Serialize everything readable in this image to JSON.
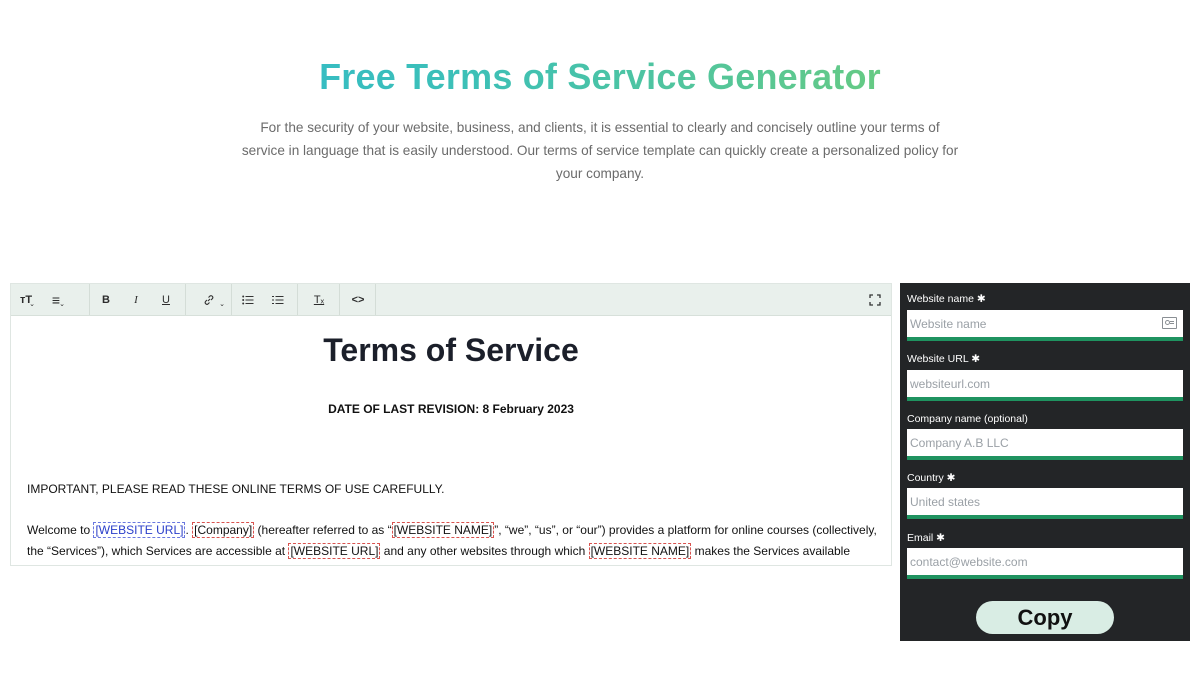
{
  "hero": {
    "title": "Free Terms of Service Generator",
    "description": "For the security of your website, business, and clients, it is essential to clearly and concisely outline your terms of service in language that is easily understood. Our terms of service template can quickly create a personalized policy for your company."
  },
  "toolbar": {
    "buttons": [
      {
        "name": "text-size-icon",
        "glyph": "ᴛT"
      },
      {
        "name": "align-icon",
        "glyph": "≡"
      },
      {
        "name": "bold-icon",
        "glyph": "B"
      },
      {
        "name": "italic-icon",
        "glyph": "I"
      },
      {
        "name": "underline-icon",
        "glyph": "U"
      },
      {
        "name": "link-icon",
        "glyph": "🔗"
      },
      {
        "name": "bullet-list-icon",
        "glyph": "☰"
      },
      {
        "name": "numbered-list-icon",
        "glyph": "☰"
      },
      {
        "name": "clear-format-icon",
        "glyph": "Tₓ"
      },
      {
        "name": "code-view-icon",
        "glyph": "<>"
      },
      {
        "name": "fullscreen-icon",
        "glyph": "⛶"
      }
    ]
  },
  "document": {
    "title": "Terms of Service",
    "date_line": "DATE OF LAST REVISION: 8 February 2023",
    "important": "IMPORTANT, PLEASE READ THESE ONLINE TERMS OF USE CAREFULLY.",
    "para": {
      "t1": "Welcome to ",
      "ph_website_url": "[WEBSITE URL]",
      "t2": ". ",
      "ph_company": "[Company]",
      "t3": " (hereafter referred to as “",
      "ph_website_name": "[WEBSITE NAME]",
      "t4": "”, “we”, “us”, or “our”) provides a platform for online courses (collectively, the “Services”), which Services are accessible at ",
      "ph_website_url_2": "[WEBSITE URL]",
      "t5": " and any other websites through which ",
      "ph_website_name_2": "[WEBSITE NAME]",
      "t6": " makes the Services available (collectively, the “Site”)."
    }
  },
  "form": {
    "website_name": {
      "label": "Website name ✱",
      "placeholder": "Website name"
    },
    "website_url": {
      "label": "Website URL ✱",
      "placeholder": "websiteurl.com"
    },
    "company_name": {
      "label": "Company name (optional)",
      "placeholder": "Company A.B LLC"
    },
    "country": {
      "label": "Country ✱",
      "placeholder": "United states"
    },
    "email": {
      "label": "Email ✱",
      "placeholder": "contact@website.com"
    },
    "copy_label": "Copy"
  },
  "colors": {
    "accent": "#1f9360",
    "panel_bg": "#232527",
    "copy_bg": "#d9ede4"
  }
}
